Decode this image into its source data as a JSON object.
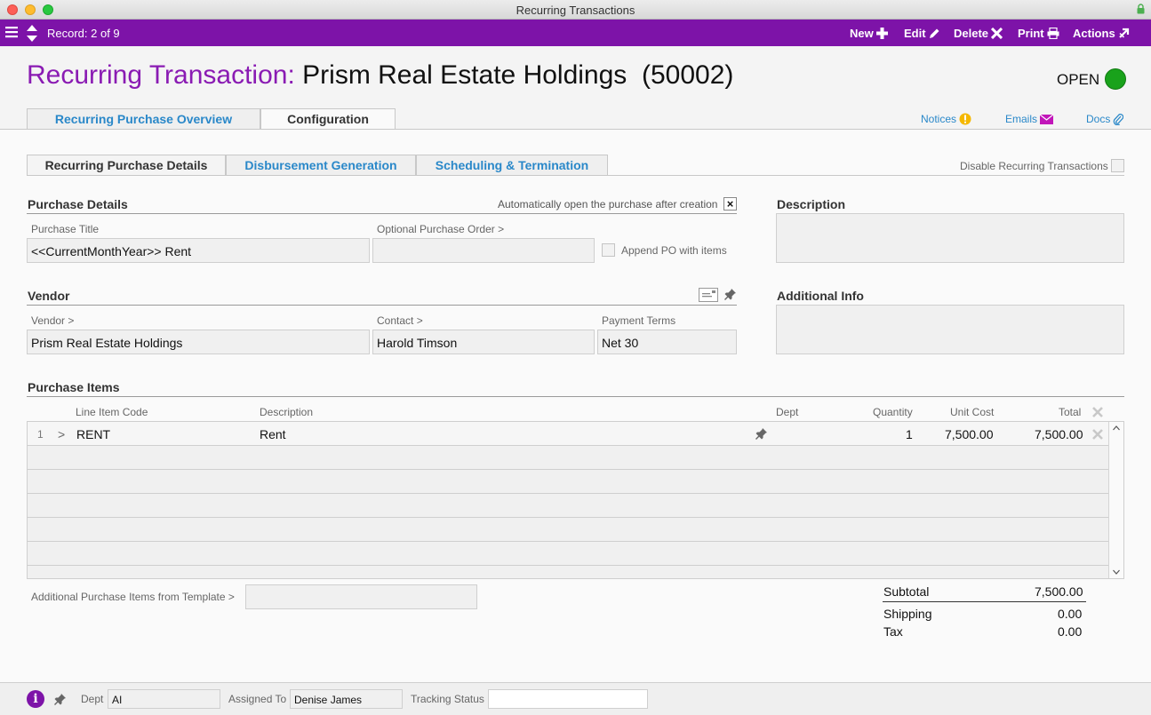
{
  "window": {
    "title": "Recurring Transactions"
  },
  "toolbar": {
    "record": "Record: 2 of 9",
    "new": "New",
    "edit": "Edit",
    "delete": "Delete",
    "print": "Print",
    "actions": "Actions"
  },
  "header": {
    "label": "Recurring Transaction:",
    "name": "Prism Real Estate Holdings  (50002)",
    "status": "OPEN",
    "status_color": "#19a21b"
  },
  "tabs": [
    "Recurring Purchase Overview",
    "Configuration"
  ],
  "links": {
    "notices": "Notices",
    "emails": "Emails",
    "docs": "Docs"
  },
  "subtabs": [
    "Recurring Purchase Details",
    "Disbursement Generation",
    "Scheduling & Termination"
  ],
  "disable_recurring": "Disable Recurring Transactions",
  "purchase_details": {
    "heading": "Purchase Details",
    "auto_open": "Automatically open the purchase after creation",
    "auto_open_mark": "×",
    "title_label": "Purchase Title",
    "title_value": "<<CurrentMonthYear>> Rent",
    "po_label": "Optional Purchase Order >",
    "po_value": "",
    "append_po": "Append PO with items"
  },
  "description": {
    "heading": "Description",
    "value": ""
  },
  "additional_info": {
    "heading": "Additional Info",
    "value": ""
  },
  "vendor": {
    "heading": "Vendor",
    "vendor_label": "Vendor >",
    "vendor_value": "Prism Real Estate Holdings",
    "contact_label": "Contact >",
    "contact_value": "Harold Timson",
    "terms_label": "Payment Terms",
    "terms_value": "Net 30"
  },
  "items": {
    "heading": "Purchase Items",
    "columns": {
      "code": "Line Item Code",
      "description": "Description",
      "dept": "Dept",
      "quantity": "Quantity",
      "unit_cost": "Unit Cost",
      "total": "Total"
    },
    "rows": [
      {
        "num": "1",
        "expand": ">",
        "code": "RENT",
        "description": "Rent",
        "dept": "",
        "quantity": "1",
        "unit_cost": "7,500.00",
        "total": "7,500.00"
      }
    ],
    "template_label": "Additional Purchase Items from Template >",
    "template_value": ""
  },
  "totals": {
    "subtotal_label": "Subtotal",
    "subtotal": "7,500.00",
    "shipping_label": "Shipping",
    "shipping": "0.00",
    "tax_label": "Tax",
    "tax": "0.00"
  },
  "footer": {
    "dept_label": "Dept",
    "dept_value": "AI",
    "assigned_label": "Assigned To",
    "assigned_value": "Denise James",
    "tracking_label": "Tracking Status",
    "tracking_value": ""
  },
  "colors": {
    "accent": "#7d13a8",
    "link": "#2a88c9",
    "heading_purple": "#8a1bb3"
  }
}
